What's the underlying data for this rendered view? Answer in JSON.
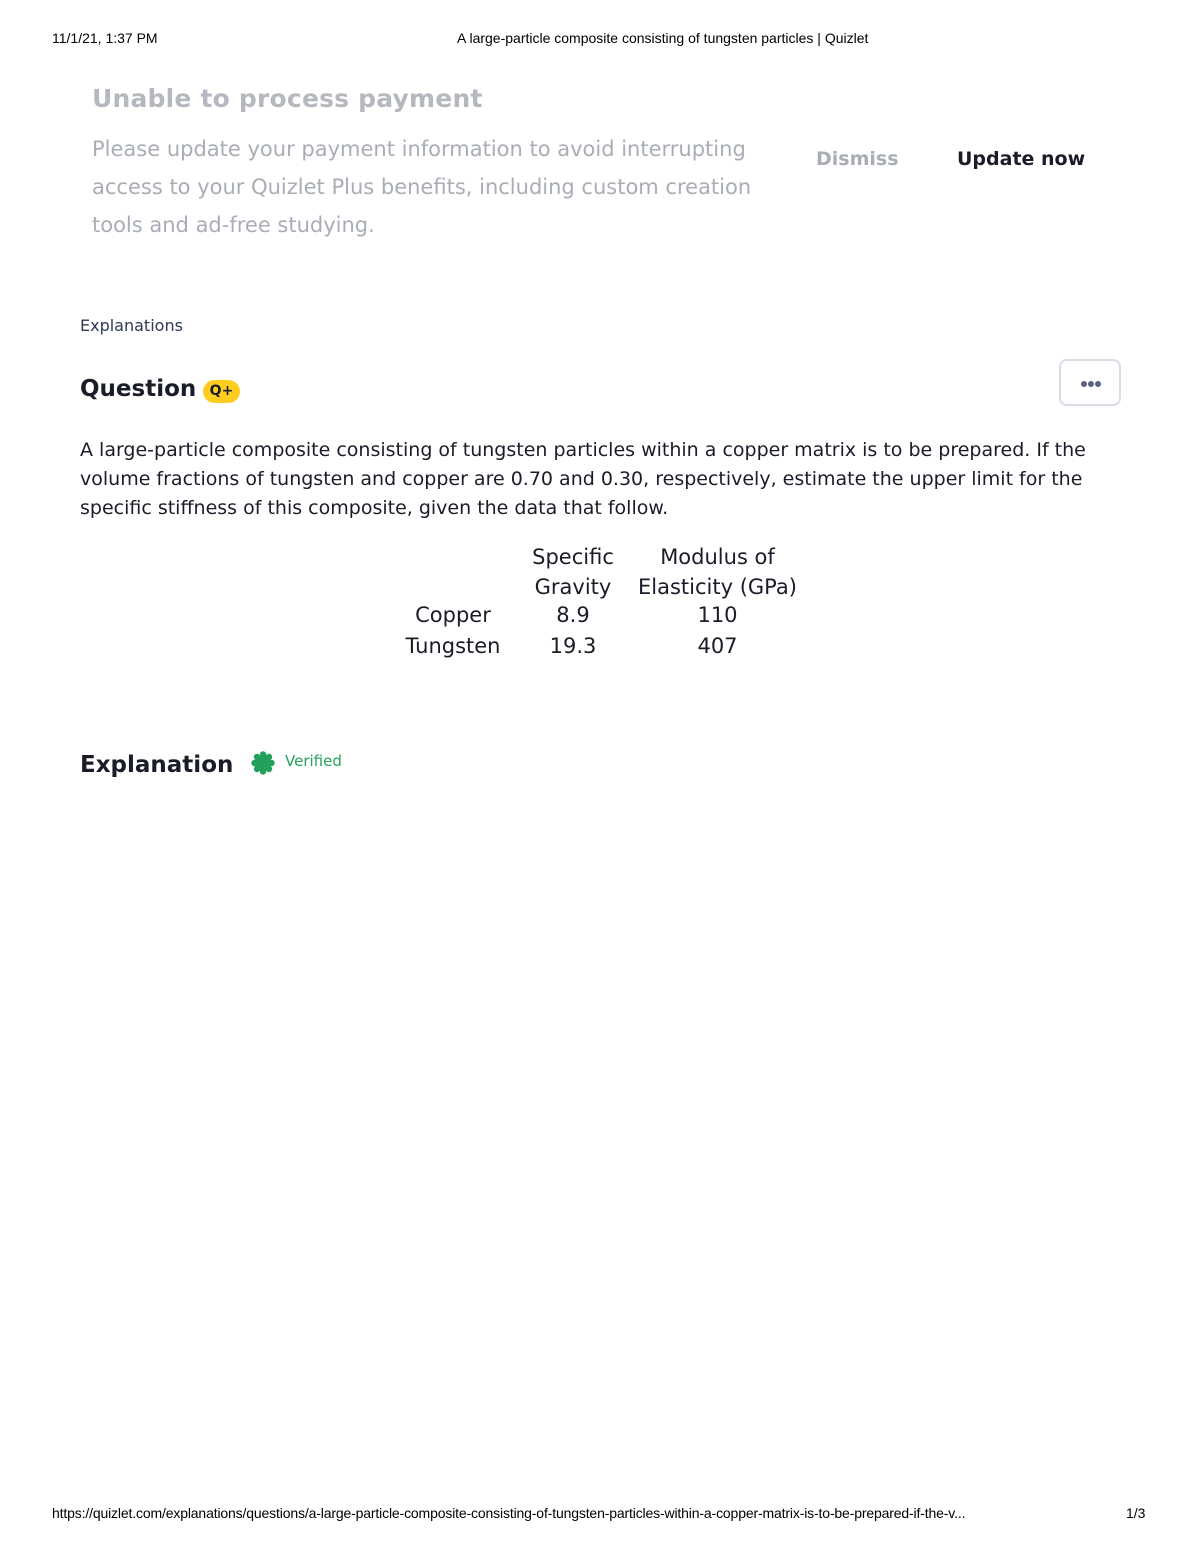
{
  "print_header": {
    "date": "11/1/21, 1:37 PM",
    "title": "A large-particle composite consisting of tungsten particles | Quizlet"
  },
  "banner": {
    "heading": "Unable to process payment",
    "message": "Please update your payment information to avoid interrupting access to your Quizlet Plus benefits, including custom creation tools and ad-free studying.",
    "dismiss_label": "Dismiss",
    "update_label": "Update now"
  },
  "breadcrumb": "Explanations",
  "question": {
    "title": "Question",
    "badge": "Q+",
    "more_icon": "ellipsis-icon",
    "text": "A large-particle composite consisting of tungsten particles within a copper matrix is to be prepared. If the volume fractions of tungsten and copper are 0.70 and 0.30, respectively, estimate the upper limit for the specific stiffness of this composite, given the data that follow.",
    "table": {
      "headers": [
        "",
        "Specific Gravity",
        "Modulus of Elasticity (GPa)"
      ],
      "header_lines": [
        [
          "Specific",
          "Gravity"
        ],
        [
          "Modulus of",
          "Elasticity (GPa)"
        ]
      ],
      "rows": [
        [
          "Copper",
          "8.9",
          "110"
        ],
        [
          "Tungsten",
          "19.3",
          "407"
        ]
      ]
    }
  },
  "explanation": {
    "title": "Explanation",
    "verified_label": "Verified",
    "verified_icon": "verified-badge-icon"
  },
  "print_footer": {
    "url": "https://quizlet.com/explanations/questions/a-large-particle-composite-consisting-of-tungsten-particles-within-a-copper-matrix-is-to-be-prepared-if-the-v...",
    "page": "1/3"
  },
  "colors": {
    "badge_yellow": "#ffcd1f",
    "verified_green": "#23a05c",
    "faded_text": "#a9adb5",
    "dark_text": "#1a1d28"
  }
}
